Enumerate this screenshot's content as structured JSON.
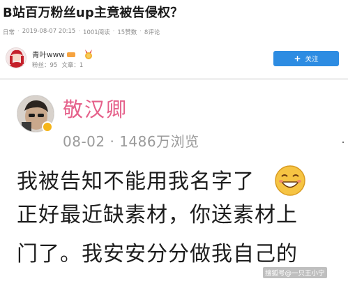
{
  "article": {
    "title": "B站百万粉丝up主竟被告侵权？",
    "meta": {
      "channel": "日常",
      "date": "2019-08-07 20:15",
      "reads": "1001阅读",
      "likes": "15赞数",
      "comments": "8评论"
    }
  },
  "author": {
    "name": "青叶www",
    "stats": {
      "fans": "粉丝：95",
      "articles": "文章：1"
    },
    "follow_label": "关注"
  },
  "post": {
    "username": "敬汉卿",
    "meta": "08-02 · 1486万浏览",
    "lines": [
      "我被告知不能用我名字了",
      "正好最近缺素材，你送素材上",
      "门了。我安安分分做我自己的"
    ]
  },
  "watermark": "搜狐号@一只王小宁",
  "colors": {
    "accent": "#2d8ce2",
    "username_pink": "#e5608a",
    "muted_text": "#9a9a9a"
  }
}
